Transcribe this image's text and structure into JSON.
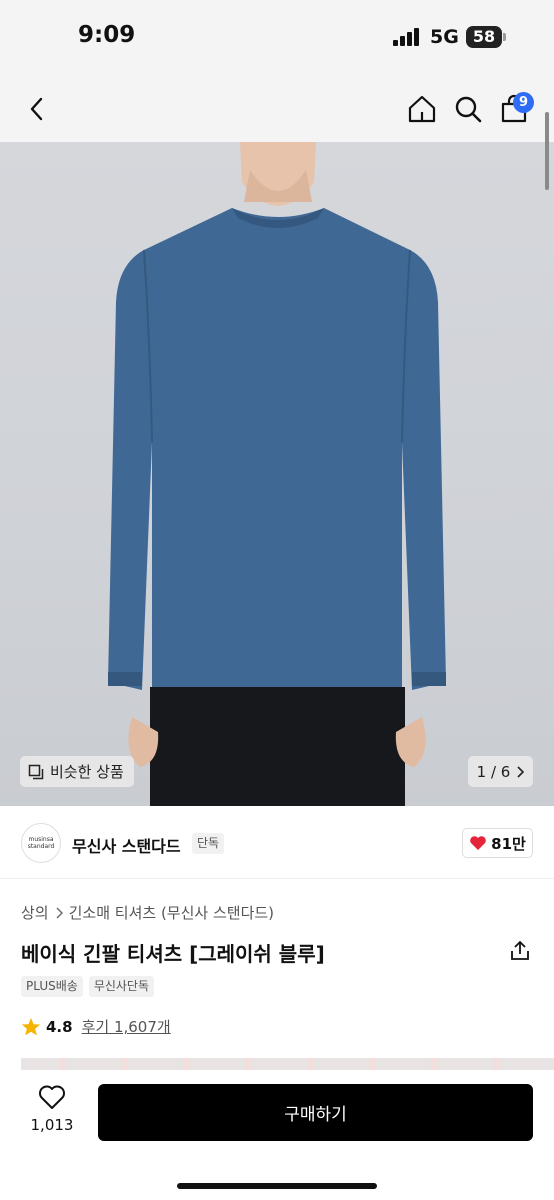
{
  "status_bar": {
    "time": "9:09",
    "network": "5G",
    "battery": "58"
  },
  "nav": {
    "cart_count": "9",
    "icons": [
      "back-icon",
      "home-icon",
      "search-icon",
      "cart-icon"
    ]
  },
  "gallery": {
    "similar_label": "비슷한 상품",
    "page_indicator": "1 / 6",
    "page_current": 1,
    "page_total": 6,
    "shirt_color": "#3f6894"
  },
  "brand": {
    "logo_line1": "musinsa",
    "logo_line2": "standard",
    "name": "무신사 스탠다드",
    "tag": "단독",
    "likes": "81만"
  },
  "product": {
    "breadcrumb": [
      "상의",
      "긴소매 티셔츠 (무신사 스탠다드)"
    ],
    "title": "베이식 긴팔 티셔츠 [그레이쉬 블루]",
    "tags": [
      "PLUS배송",
      "무신사단독"
    ],
    "rating": "4.8",
    "reviews": "후기 1,607개"
  },
  "bottom_bar": {
    "wish_count": "1,013",
    "buy_label": "구매하기"
  },
  "colors": {
    "accent_badge": "#2f6cf5",
    "like_heart": "#e4253a",
    "star": "#f5b400",
    "buy_button": "#000000"
  }
}
